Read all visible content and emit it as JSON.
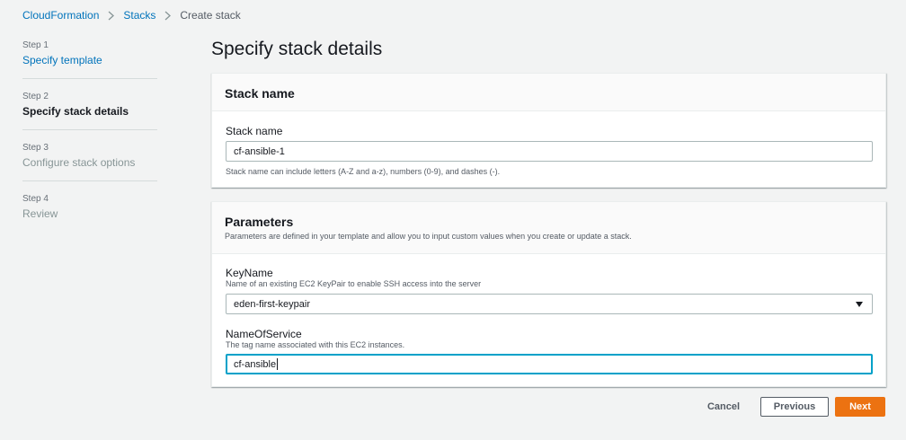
{
  "breadcrumb": {
    "root": "CloudFormation",
    "stacks": "Stacks",
    "current": "Create stack"
  },
  "steps": [
    {
      "num": "Step 1",
      "title": "Specify template",
      "state": "link"
    },
    {
      "num": "Step 2",
      "title": "Specify stack details",
      "state": "active"
    },
    {
      "num": "Step 3",
      "title": "Configure stack options",
      "state": "disabled"
    },
    {
      "num": "Step 4",
      "title": "Review",
      "state": "disabled"
    }
  ],
  "page_title": "Specify stack details",
  "stack_name_panel": {
    "title": "Stack name",
    "label": "Stack name",
    "value": "cf-ansible-1",
    "hint": "Stack name can include letters (A-Z and a-z), numbers (0-9), and dashes (-)."
  },
  "parameters_panel": {
    "title": "Parameters",
    "description": "Parameters are defined in your template and allow you to input custom values when you create or update a stack.",
    "keyname": {
      "label": "KeyName",
      "description": "Name of an existing EC2 KeyPair to enable SSH access into the server",
      "value": "eden-first-keypair"
    },
    "nameofservice": {
      "label": "NameOfService",
      "description": "The tag name associated with this EC2 instances.",
      "value": "cf-ansible"
    }
  },
  "actions": {
    "cancel": "Cancel",
    "previous": "Previous",
    "next": "Next"
  },
  "colors": {
    "link": "#0073bb",
    "primary_button": "#ec7211",
    "focus": "#00a1c9"
  }
}
